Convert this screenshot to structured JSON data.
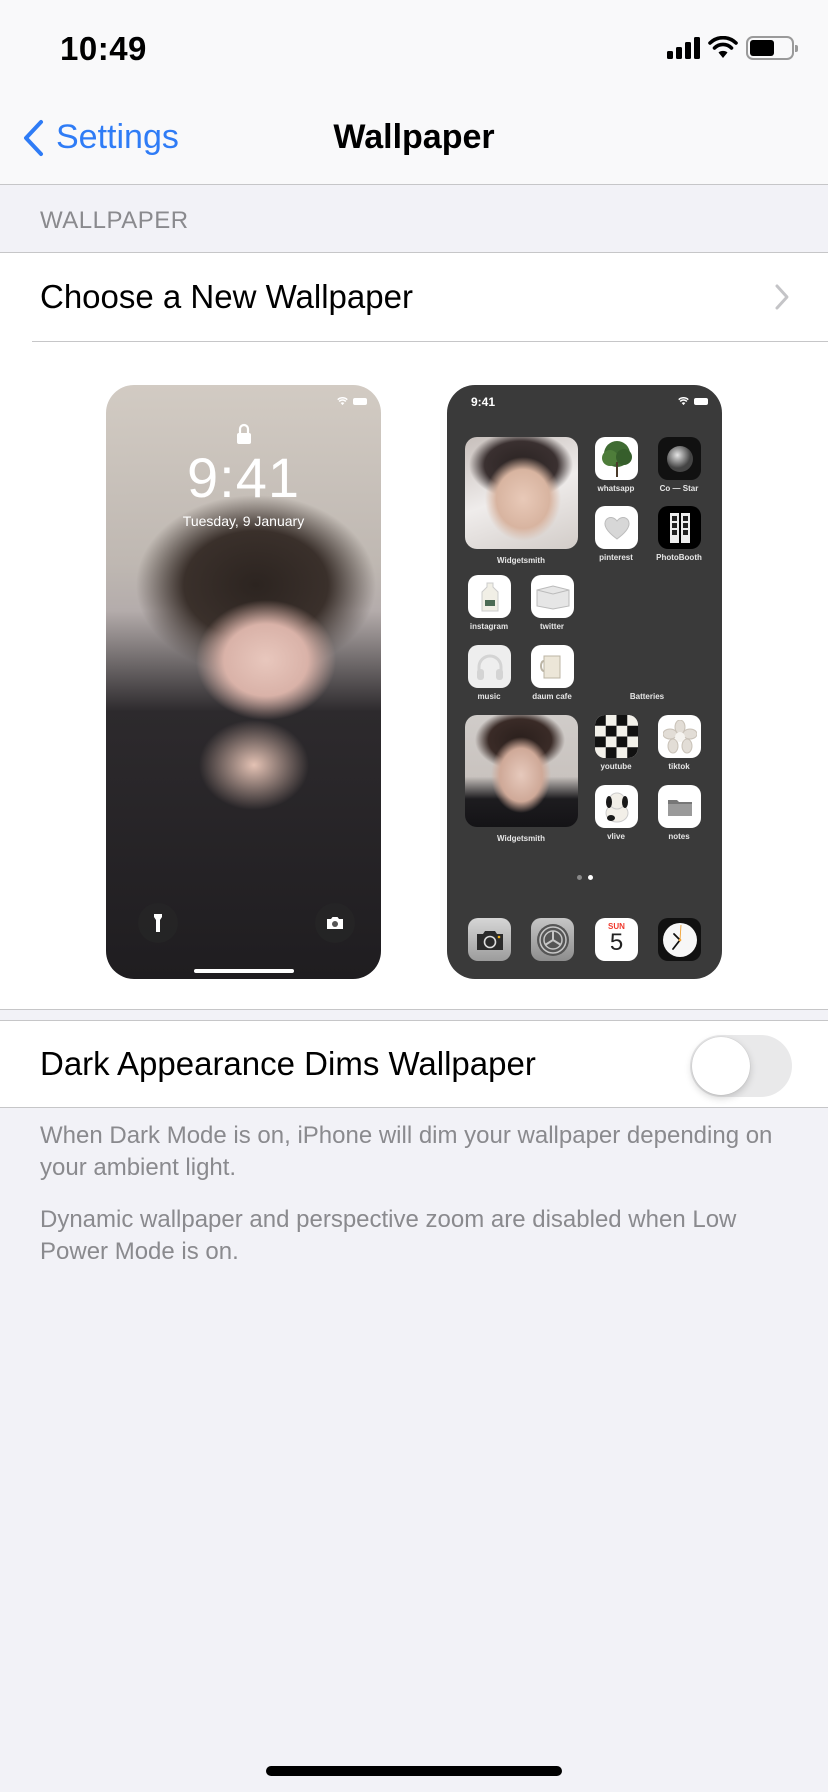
{
  "status_bar": {
    "time": "10:49",
    "battery_level": 0.6
  },
  "nav": {
    "back_label": "Settings",
    "title": "Wallpaper"
  },
  "section": {
    "header": "WALLPAPER"
  },
  "choose_row": {
    "label": "Choose a New Wallpaper"
  },
  "lock_preview": {
    "time": "9:41",
    "date": "Tuesday, 9 January"
  },
  "home_preview": {
    "time": "9:41",
    "widgets": [
      {
        "label": "Widgetsmith"
      },
      {
        "label": "Batteries"
      },
      {
        "label": "Widgetsmith"
      }
    ],
    "apps": [
      {
        "label": "whatsapp",
        "icon": "tree-icon"
      },
      {
        "label": "Co — Star",
        "icon": "moon-icon"
      },
      {
        "label": "pinterest",
        "icon": "heart-stone-icon"
      },
      {
        "label": "PhotoBooth",
        "icon": "film-strip-icon"
      },
      {
        "label": "instagram",
        "icon": "milk-jug-icon"
      },
      {
        "label": "twitter",
        "icon": "box-icon"
      },
      {
        "label": "music",
        "icon": "headphones-icon"
      },
      {
        "label": "daum cafe",
        "icon": "mug-icon"
      },
      {
        "label": "youtube",
        "icon": "checkerboard-icon"
      },
      {
        "label": "tiktok",
        "icon": "flower-icon"
      },
      {
        "label": "vlive",
        "icon": "plush-dog-icon"
      },
      {
        "label": "notes",
        "icon": "folder-icon"
      }
    ],
    "dock": [
      {
        "name": "camera",
        "icon": "camera-icon"
      },
      {
        "name": "settings",
        "icon": "gear-icon"
      },
      {
        "name": "calendar",
        "icon": "calendar-icon",
        "day": "SUN",
        "date": "5"
      },
      {
        "name": "clock",
        "icon": "clock-icon"
      }
    ],
    "page_dots": 2,
    "active_page": 2
  },
  "dark_row": {
    "label": "Dark Appearance Dims Wallpaper",
    "toggle_on": false
  },
  "footnotes": [
    "When Dark Mode is on, iPhone will dim your wallpaper depending on your ambient light.",
    "Dynamic wallpaper and perspective zoom are disabled when Low Power Mode is on."
  ],
  "colors": {
    "accent": "#2f7cf6",
    "background": "#f2f2f7",
    "secondary_text": "#8a8a8e",
    "toggle_off": "#e9e9ea"
  }
}
